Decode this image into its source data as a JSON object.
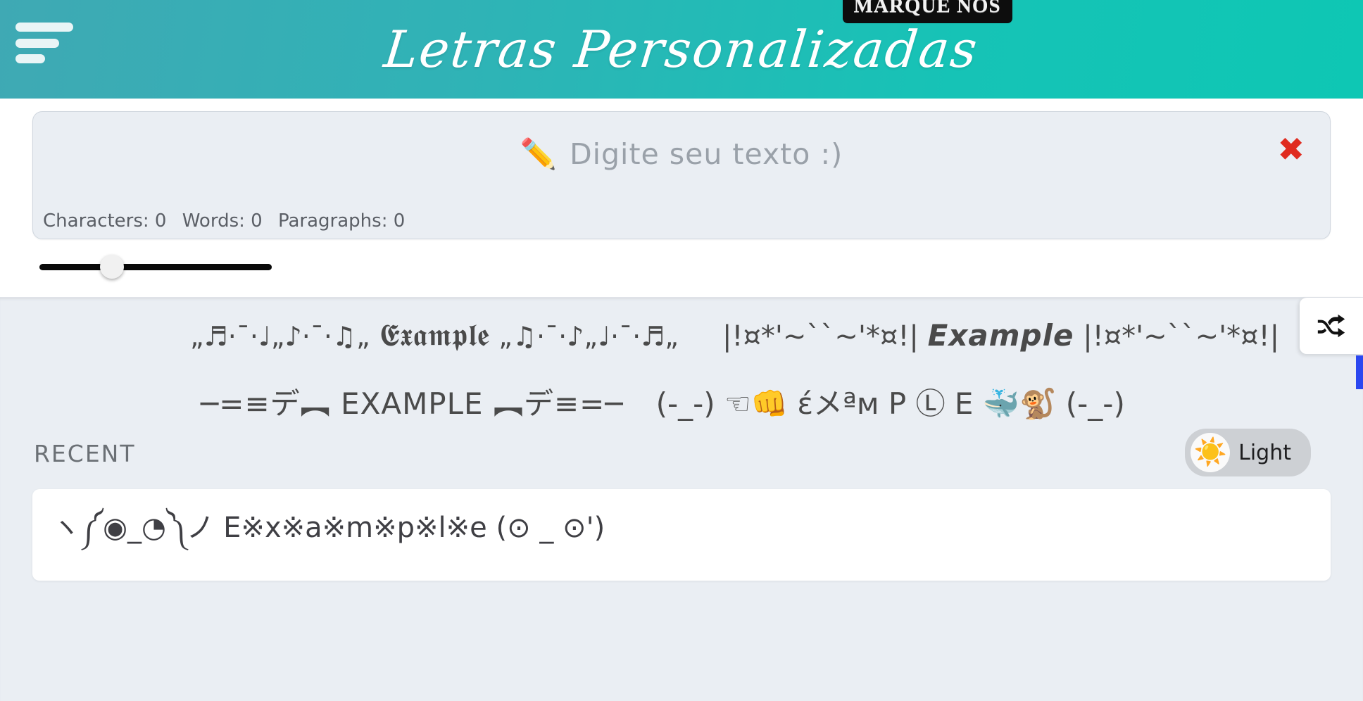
{
  "header": {
    "menu_icon": "hamburger-menu-icon",
    "brand_title": "Letras Personalizadas",
    "badge_label": "MARQUE NOS",
    "background_start": "#3fa9b4",
    "background_end": "#0ec7b4"
  },
  "editor": {
    "pencil_icon": "✏️",
    "placeholder": "Digite seu texto :)",
    "value": "",
    "clear_icon": "✖",
    "clear_color": "#e02b1f",
    "stats": {
      "characters": "Characters: 0",
      "words": "Words: 0",
      "paragraphs": "Paragraphs: 0"
    }
  },
  "slider": {
    "value_percent": 29,
    "track_color": "#0a0a0a",
    "thumb_color": "#f1f1f1"
  },
  "results": {
    "shuffle_icon": "shuffle-icon",
    "rows": [
      [
        {
          "prefix": "„♬·¯·♩„♪·¯·♫„",
          "word": "𝕰𝖝𝖆𝖒𝖕𝖑𝖊",
          "suffix": "„♫·¯·♪„♩·¯·♬„",
          "style": "fraktur"
        },
        {
          "prefix": "|!¤*'~``~'*¤!|",
          "word": "Example",
          "suffix": "|!¤*'~``~'*¤!|",
          "style": "bold-italic"
        }
      ],
      [
        {
          "prefix": "─=≡デ︻",
          "word": "EXAMPLE",
          "suffix": "︻デ≡=─",
          "style": "plain-caps"
        },
        {
          "prefix": "(-_-) ☜👊",
          "word": "έメªм P Ⓛ E",
          "suffix": "🐳🐒 (-_-)",
          "style": "mixed-fancy"
        }
      ]
    ]
  },
  "recent": {
    "title": "RECENT",
    "items": [
      "ヽ༼◉_◔༽ノ E※x※a※m※p※l※e (⊙ _ ⊙')"
    ]
  },
  "theme": {
    "icon": "☀️",
    "label": "Light",
    "pill_color": "#cdd0d4"
  }
}
